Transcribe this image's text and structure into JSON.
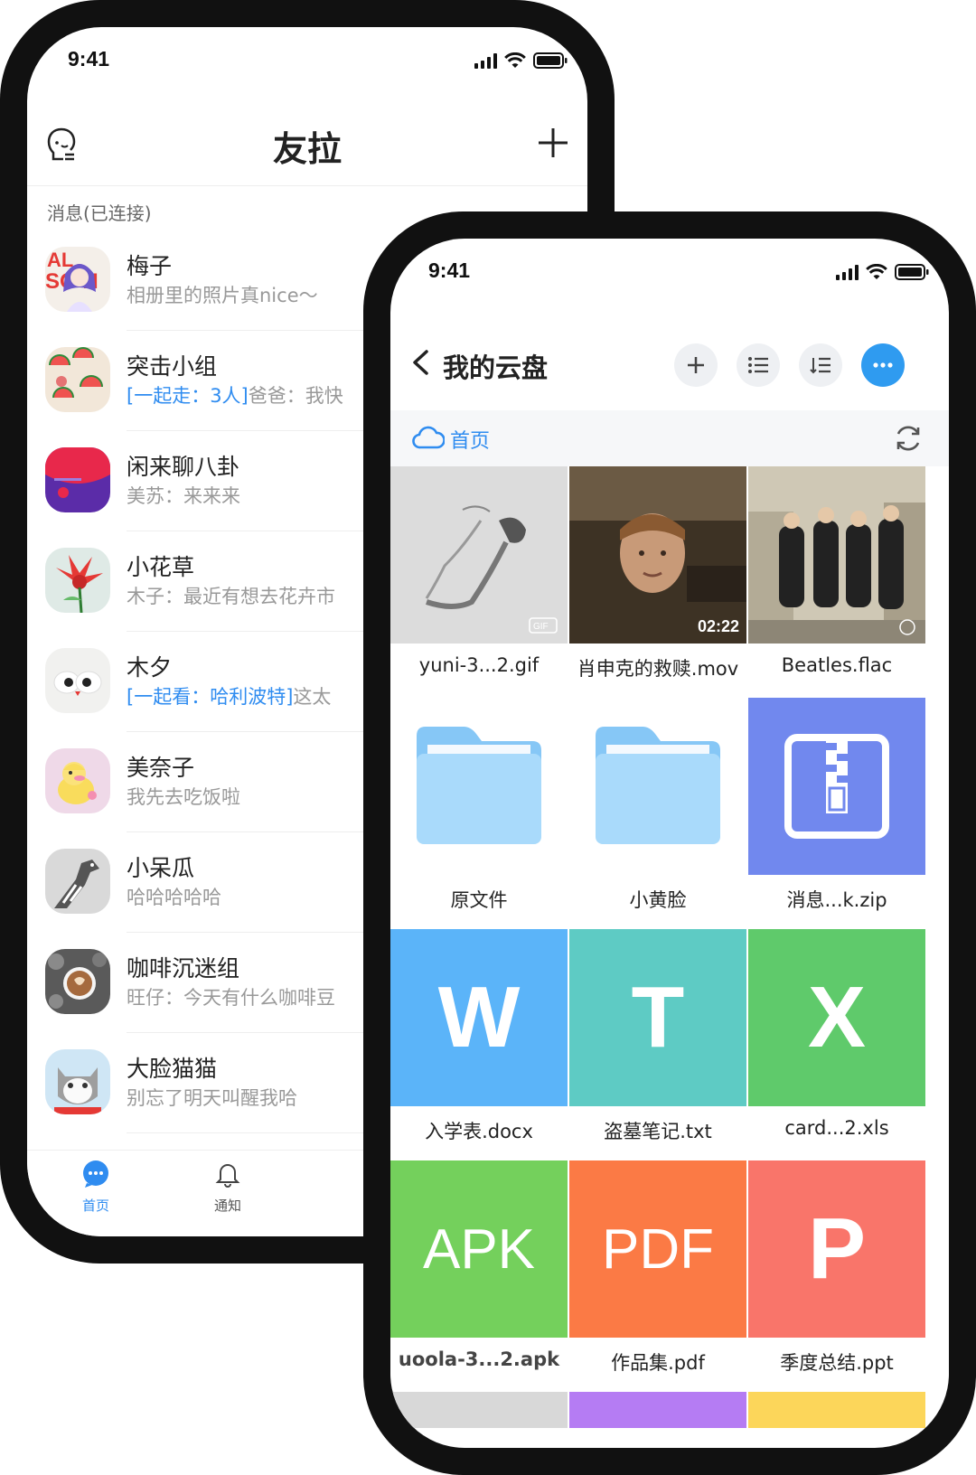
{
  "colors": {
    "accent": "#2f8cf0",
    "word": "#5bb4f9",
    "txt": "#5ecbc4",
    "xls": "#5fca6b",
    "apk": "#74d05c",
    "pdf": "#fb7a45",
    "ppt": "#f9756a",
    "zip": "#7188ee",
    "folder": "#a9dafb"
  },
  "chat_phone": {
    "status_time": "9:41",
    "title": "友拉",
    "section_label": "消息(已连接)",
    "chats": [
      {
        "name": "梅子",
        "preview": "相册里的照片真nice～",
        "avatar": "portrait"
      },
      {
        "name": "突击小组",
        "preview_highlight": "[一起走：3人]",
        "preview": "爸爸：我快",
        "avatar": "watermelon"
      },
      {
        "name": "闲来聊八卦",
        "preview": "美苏：来来来",
        "avatar": "poster"
      },
      {
        "name": "小花草",
        "preview": "木子：最近有想去花卉市",
        "avatar": "flower"
      },
      {
        "name": "木夕",
        "preview_highlight": "[一起看：哈利波特]",
        "preview": "这太",
        "avatar": "eggs"
      },
      {
        "name": "美奈子",
        "preview": "我先去吃饭啦",
        "avatar": "duck"
      },
      {
        "name": "小呆瓜",
        "preview": "哈哈哈哈哈",
        "avatar": "giraffe"
      },
      {
        "name": "咖啡沉迷组",
        "preview": "旺仔：今天有什么咖啡豆",
        "avatar": "coffee"
      },
      {
        "name": "大脸猫猫",
        "preview": "别忘了明天叫醒我哈",
        "avatar": "cat"
      }
    ],
    "tabs": [
      {
        "label": "首页",
        "icon": "chat-bubble-icon",
        "active": true
      },
      {
        "label": "通知",
        "icon": "bell-icon",
        "active": false
      }
    ]
  },
  "drive_phone": {
    "status_time": "9:41",
    "title": "我的云盘",
    "path_label": "首页",
    "files": [
      {
        "name": "yuni-3...2.gif",
        "kind": "gif"
      },
      {
        "name": "肖申克的救赎.mov",
        "kind": "video",
        "duration": "02:22"
      },
      {
        "name": "Beatles.flac",
        "kind": "music"
      },
      {
        "name": "原文件",
        "kind": "folder"
      },
      {
        "name": "小黄脸",
        "kind": "folder"
      },
      {
        "name": "消息...k.zip",
        "kind": "zip"
      },
      {
        "name": "入学表.docx",
        "kind": "word",
        "letter": "W"
      },
      {
        "name": "盗墓笔记.txt",
        "kind": "txt",
        "letter": "T"
      },
      {
        "name": "card...2.xls",
        "kind": "xls",
        "letter": "X"
      },
      {
        "name": "uoola-3...2.apk",
        "kind": "apk",
        "letter": "APK"
      },
      {
        "name": "作品集.pdf",
        "kind": "pdf",
        "letter": "PDF"
      },
      {
        "name": "季度总结.ppt",
        "kind": "ppt",
        "letter": "P"
      }
    ]
  }
}
